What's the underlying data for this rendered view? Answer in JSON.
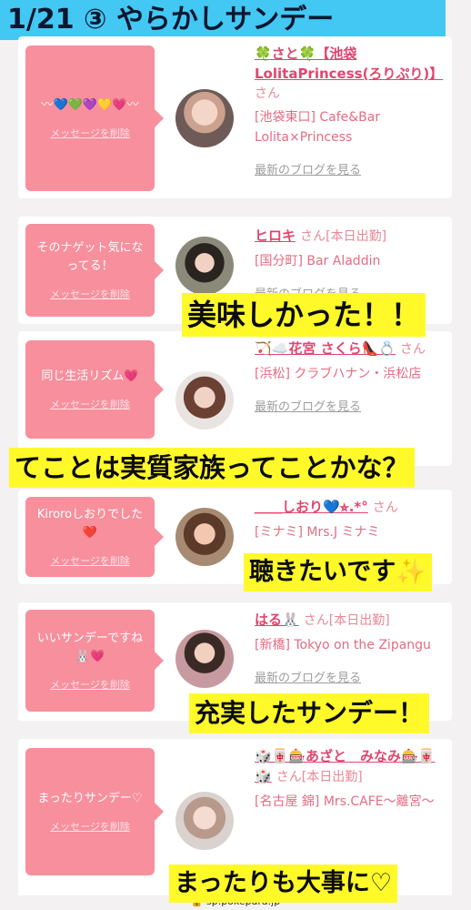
{
  "banner": {
    "title": "1/21 ③ やらかしサンデー"
  },
  "common": {
    "delete_label": "メッセージを削除",
    "san": "さん",
    "blog_label": "最新のブログを見る"
  },
  "cards": [
    {
      "message": "〰💙💚💜💛💗〰",
      "name": "🍀さと🍀【池袋LolitaPrincess(ろりぷり)】",
      "status": "",
      "shop": "[池袋東口] Cafe&Bar Lolita×Princess"
    },
    {
      "message": "そのナゲット気になってる！",
      "name": "ヒロキ",
      "status": "[本日出勤]",
      "shop": "[国分町] Bar Aladdin"
    },
    {
      "message": "同じ生活リズム💗",
      "name": "🏹☁️花宮 さくら👠💍",
      "status": "",
      "shop": "[浜松] クラブハナン・浜松店"
    },
    {
      "message": "Kiroroしおりでした❤️",
      "name": "＿＿しおり💙⭐︎.*°",
      "status": "",
      "shop": "[ミナミ] Mrs.J ミナミ"
    },
    {
      "message": "いいサンデーですね🐰💗",
      "name": "はる🐰",
      "status": "[本日出勤]",
      "shop": "[新橋] Tokyo on the Zipangu"
    },
    {
      "message": "まったりサンデー♡",
      "name": "🎲🀄🎰あざと　みなみ🎰🀄🎲",
      "status": "[本日出勤]",
      "shop": "[名古屋 錦] Mrs.CAFE〜離宮〜"
    }
  ],
  "captions": {
    "c1": "美味しかった！！",
    "c2": "てことは実質家族ってことかな？",
    "c3": "聴きたいです✨",
    "c4": "充実したサンデー！",
    "c5": "まったりも大事に♡"
  },
  "url": "🔒 sp.pokepara.jp"
}
